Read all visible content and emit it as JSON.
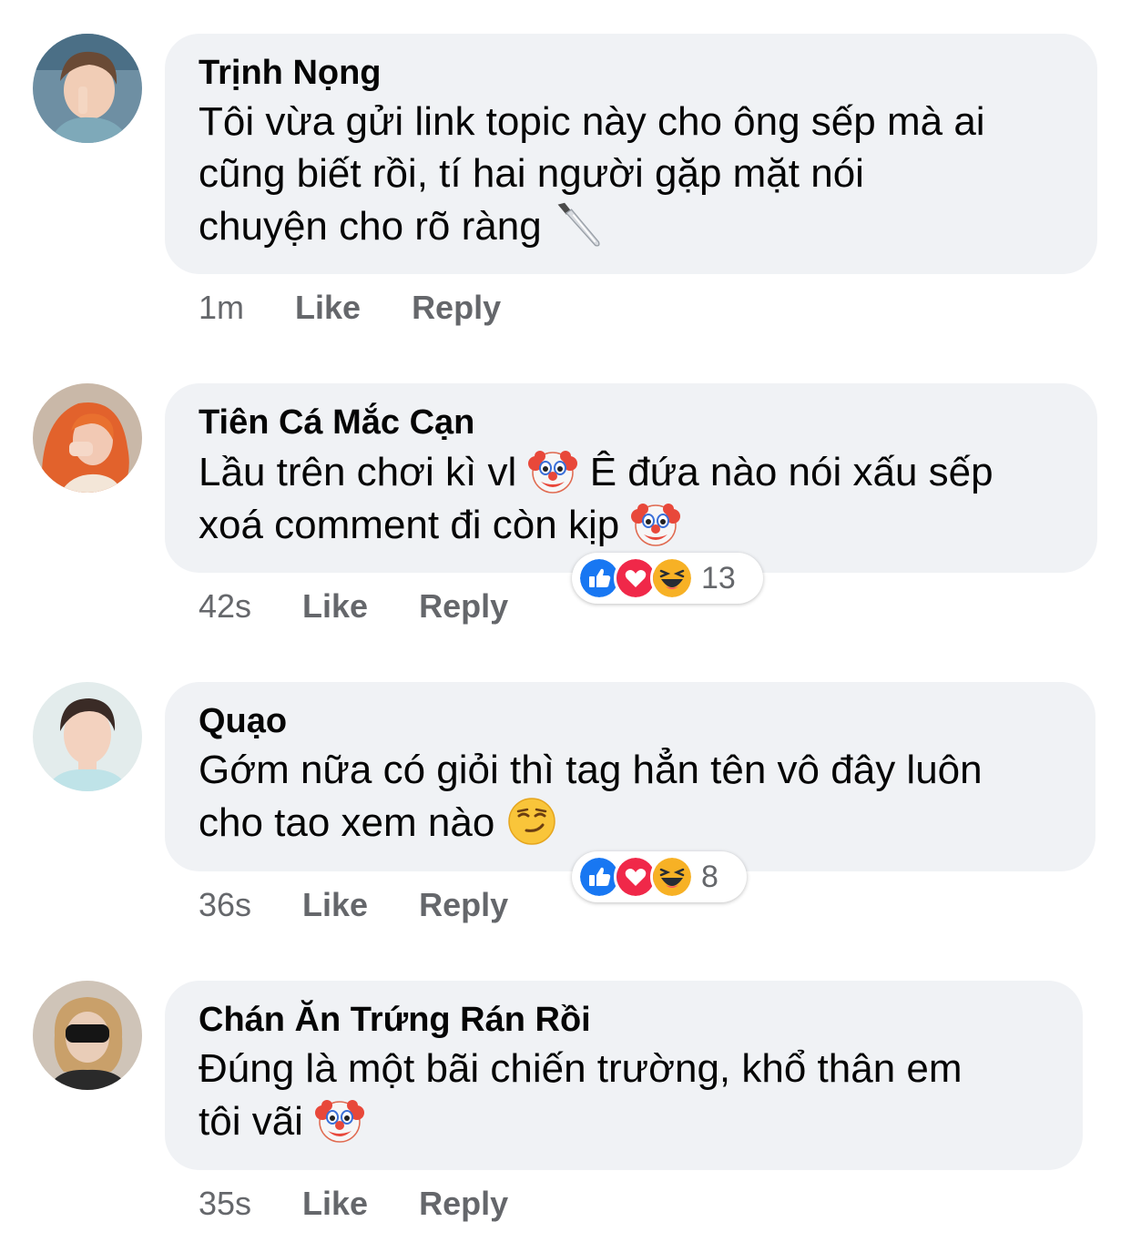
{
  "comments": [
    {
      "author": "Trịnh Nọng",
      "lines": [
        "Tôi vừa gửi link topic này cho ông sếp mà ai",
        "cũng biết rồi, tí hai người gặp mặt nói",
        "chuyện cho rõ ràng"
      ],
      "emoji_end": "knife-emoji",
      "time": "1m",
      "like_label": "Like",
      "reply_label": "Reply"
    },
    {
      "author": "Tiên Cá Mắc Cạn",
      "line1_a": "Lầu trên chơi kì vl",
      "line1_b": "Ê đứa nào nói xấu sếp",
      "line2": "xoá comment đi còn kịp",
      "emoji": "clown-emoji",
      "time": "42s",
      "like_label": "Like",
      "reply_label": "Reply",
      "reaction_count": "13"
    },
    {
      "author": "Quạo",
      "lines": [
        "Gớm nữa có giỏi thì tag hẳn tên vô đây luôn",
        "cho tao xem nào"
      ],
      "emoji_end": "smirk-emoji",
      "time": "36s",
      "like_label": "Like",
      "reply_label": "Reply",
      "reaction_count": "8"
    },
    {
      "author": "Chán Ăn Trứng Rán Rồi",
      "lines": [
        "Đúng là một bãi chiến trường, khổ thân em",
        "tôi vãi"
      ],
      "emoji_end": "clown-emoji",
      "time": "35s",
      "like_label": "Like",
      "reply_label": "Reply"
    }
  ],
  "colors": {
    "bubble": "#f0f2f5",
    "secondary_text": "#65676b",
    "like_blue": "#1877f2",
    "love_red": "#f02849",
    "haha_yellow": "#f7b125"
  }
}
